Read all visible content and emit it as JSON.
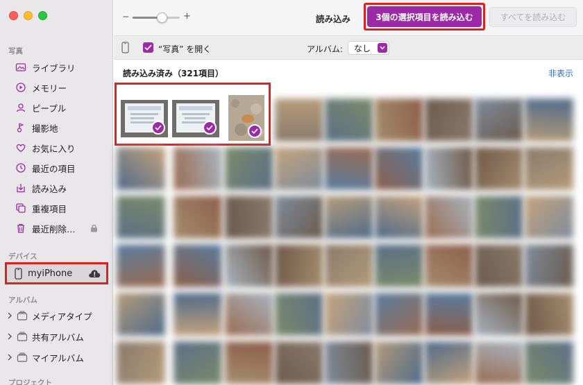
{
  "sidebar": {
    "section_photos": "写真",
    "items": [
      {
        "label": "ライブラリ",
        "icon": "library-icon"
      },
      {
        "label": "メモリー",
        "icon": "memories-icon"
      },
      {
        "label": "ピープル",
        "icon": "people-icon"
      },
      {
        "label": "撮影地",
        "icon": "places-icon"
      },
      {
        "label": "お気に入り",
        "icon": "heart-icon"
      },
      {
        "label": "最近の項目",
        "icon": "clock-icon"
      },
      {
        "label": "読み込み",
        "icon": "import-icon"
      },
      {
        "label": "重複項目",
        "icon": "duplicates-icon"
      },
      {
        "label": "最近削除…",
        "icon": "trash-icon"
      }
    ],
    "section_devices": "デバイス",
    "device": {
      "label": "myiPhone"
    },
    "section_albums": "アルバム",
    "albums": [
      {
        "label": "メディアタイプ"
      },
      {
        "label": "共有アルバム"
      },
      {
        "label": "マイアルバム"
      }
    ],
    "section_projects": "プロジェクト"
  },
  "toolbar": {
    "zoom_minus": "−",
    "zoom_plus": "+",
    "zoom_level": 0.62,
    "import_label": "読み込み",
    "import_selected_label": "3個の選択項目を読み込む",
    "import_all_label": "すべてを読み込む"
  },
  "options": {
    "open_photos_label": "“写真” を開く",
    "open_photos_checked": true,
    "album_label": "アルバム:",
    "album_value": "なし"
  },
  "content": {
    "imported_title": "読み込み済み（321項目）",
    "hide_label": "非表示"
  },
  "colors": {
    "accent": "#9c2aa6",
    "highlight": "#e01f1f",
    "link": "#1f6fd1"
  }
}
